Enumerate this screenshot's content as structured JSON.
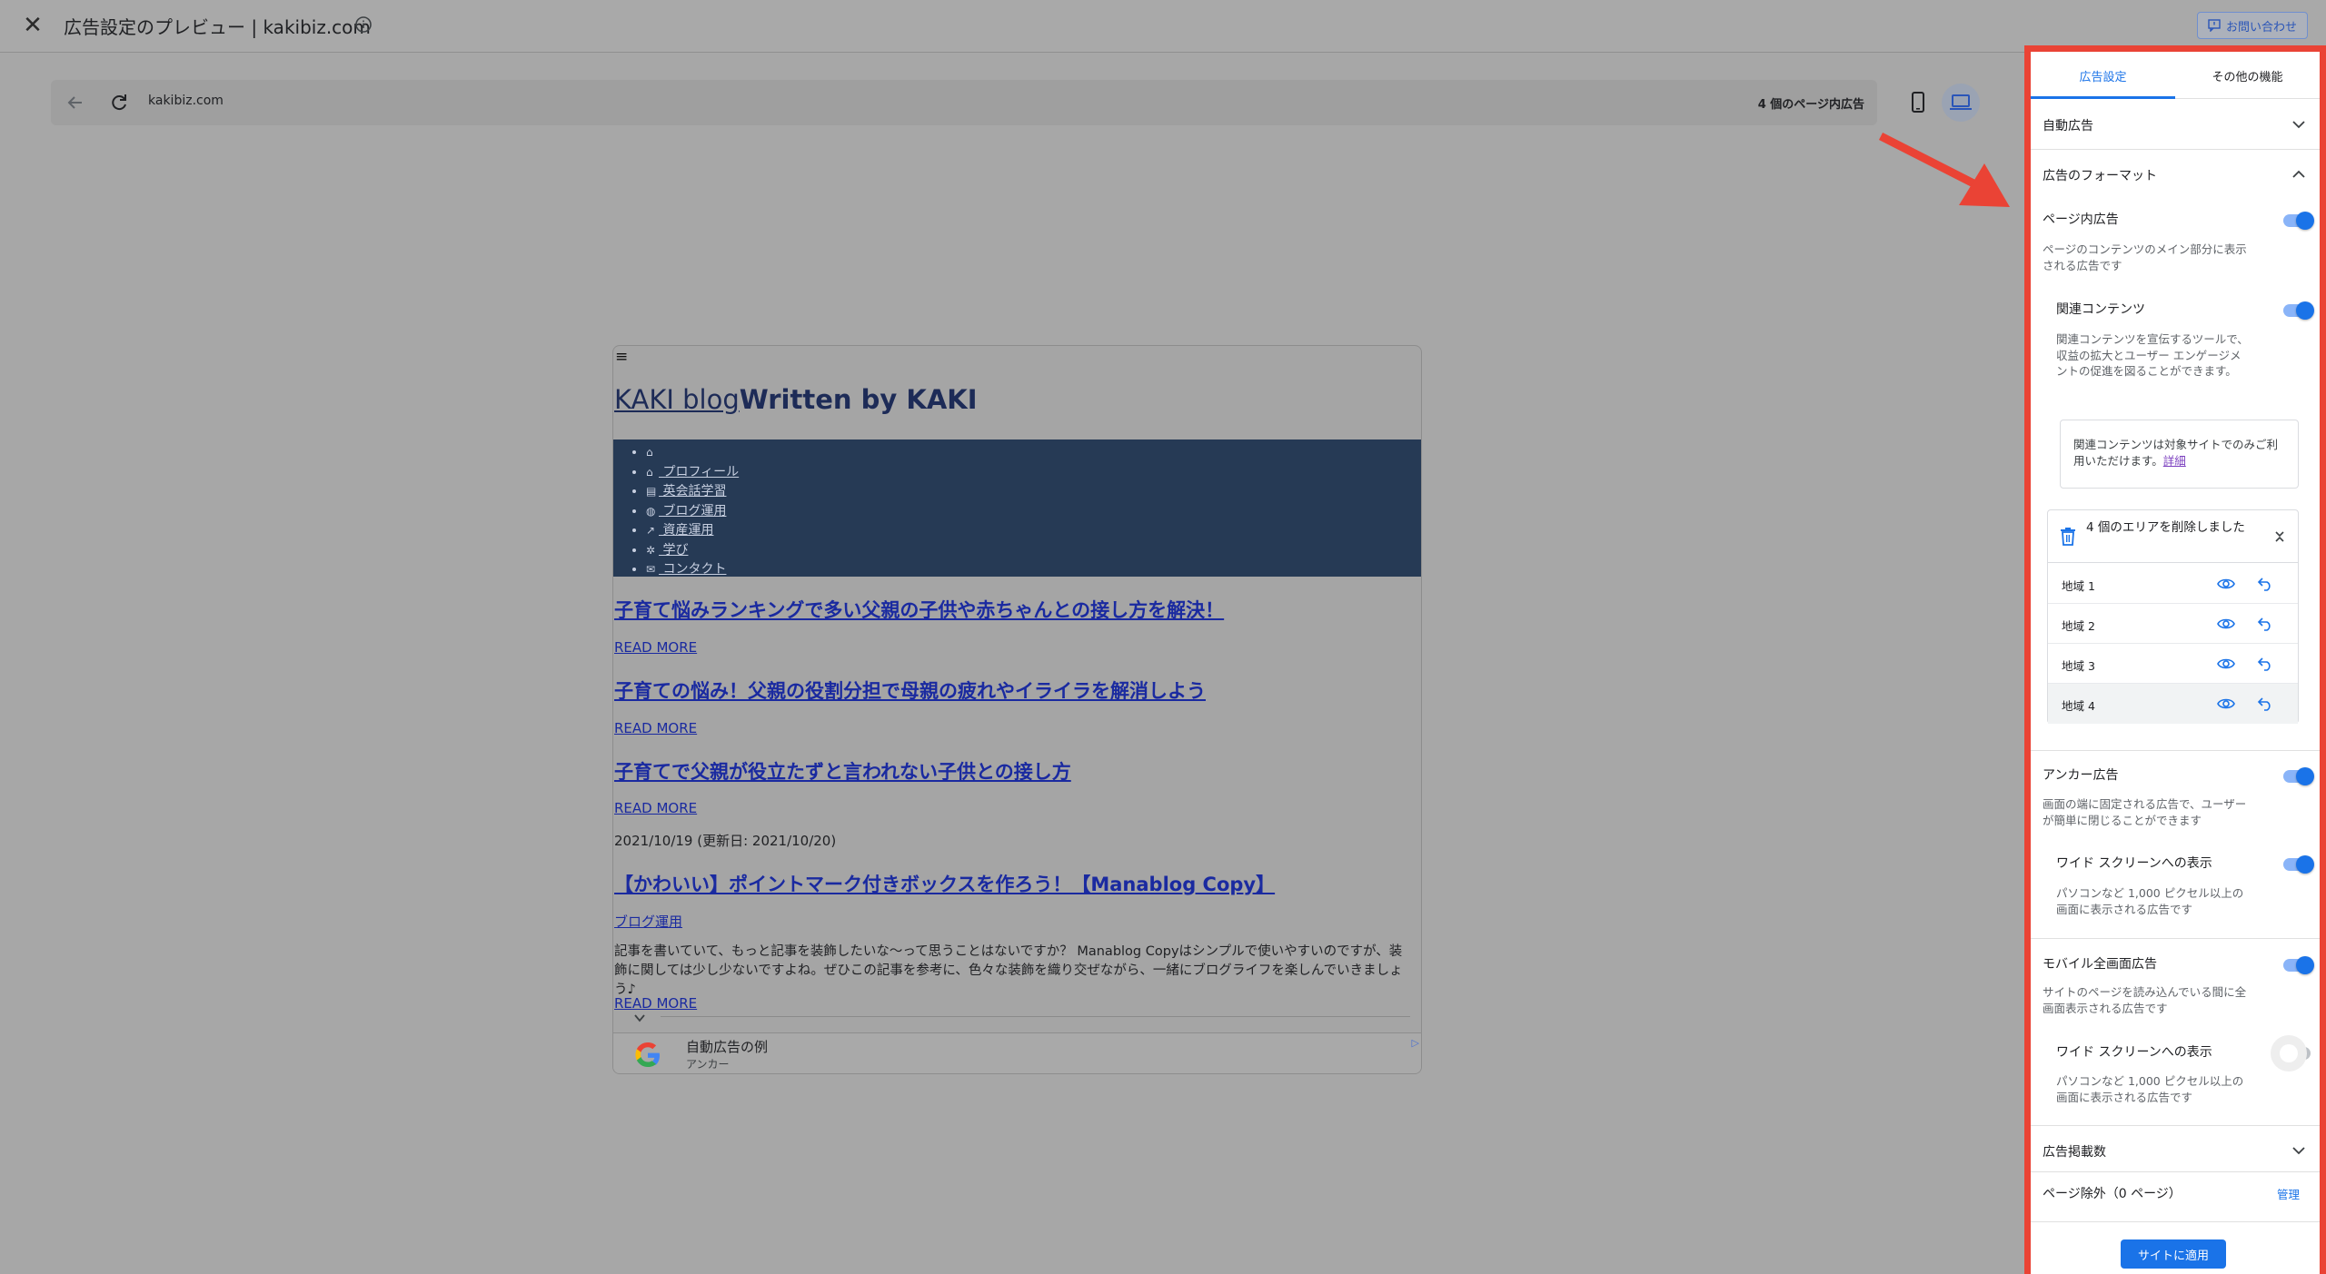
{
  "header": {
    "title": "広告設定のプレビュー | kakibiz.com",
    "contact_label": "お問い合わせ"
  },
  "addressbar": {
    "url": "kakibiz.com",
    "ads_count": "4 個のページ内広告"
  },
  "preview": {
    "hamburger": "≡",
    "blog_title_part1": "KAKI blog",
    "blog_title_part2": "Written by KAKI",
    "nav_items": [
      {
        "icon": "home-icon",
        "label": ""
      },
      {
        "icon": "home-icon",
        "label": " プロフィール"
      },
      {
        "icon": "book-icon",
        "label": " 英会話学習"
      },
      {
        "icon": "globe-icon",
        "label": " ブログ運用"
      },
      {
        "icon": "chart-icon",
        "label": " 資産運用"
      },
      {
        "icon": "spinner-icon",
        "label": " 学び"
      },
      {
        "icon": "mail-icon",
        "label": " コンタクト"
      }
    ],
    "posts": [
      "子育て悩みランキングで多い父親の子供や赤ちゃんとの接し方を解決！",
      "子育ての悩み！父親の役割分担で母親の疲れやイライラを解消しよう",
      "子育てで父親が役立たずと言われない子供との接し方",
      "【かわいい】ポイントマーク付きボックスを作ろう！【Manablog Copy】"
    ],
    "read_more": "READ MORE",
    "date": "2021/10/19 (更新日: 2021/10/20)",
    "category": "ブログ運用",
    "excerpt": "記事を書いていて、もっと記事を装飾したいな〜って思うことはないですか？ Manablog Copyはシンプルで使いやすいのですが、装飾に関しては少し少ないですよね。ぜひこの記事を参考に、色々な装飾を織り交ぜながら、一緒にブログライフを楽しんでいきましょう♪",
    "anchor_ad_title": "自動広告の例",
    "anchor_ad_sub": "アンカー"
  },
  "panel": {
    "tabs": [
      "広告設定",
      "その他の機能"
    ],
    "auto_ads": "自動広告",
    "ad_formats": "広告のフォーマット",
    "in_page": {
      "title": "ページ内広告",
      "desc": "ページのコンテンツのメイン部分に表示される広告です",
      "enabled": true
    },
    "related": {
      "title": "関連コンテンツ",
      "desc": "関連コンテンツを宣伝するツールで、収益の拡大とユーザー エンゲージメントの促進を図ることができます。",
      "enabled": true,
      "notice": "関連コンテンツは対象サイトでのみご利用いただけます。",
      "notice_link": "詳細"
    },
    "removed": {
      "header": "4 個のエリアを削除しました",
      "areas": [
        "地域 1",
        "地域 2",
        "地域 3",
        "地域 4"
      ]
    },
    "anchor": {
      "title": "アンカー広告",
      "desc": "画面の端に固定される広告で、ユーザーが簡単に閉じることができます",
      "enabled": true,
      "wide_title": "ワイド スクリーンへの表示",
      "wide_desc": "パソコンなど 1,000 ピクセル以上の画面に表示される広告です",
      "wide_enabled": true
    },
    "vignette": {
      "title": "モバイル全画面広告",
      "desc": "サイトのページを読み込んでいる間に全画面表示される広告です",
      "enabled": true,
      "wide_title": "ワイド スクリーンへの表示",
      "wide_desc": "パソコンなど 1,000 ピクセル以上の画面に表示される広告です",
      "wide_enabled": false
    },
    "ad_load": "広告掲載数",
    "page_exclusion": "ページ除外（0 ページ）",
    "manage": "管理",
    "apply": "サイトに適用"
  },
  "colors": {
    "accent": "#1a73e8",
    "highlight_border": "#ea4335",
    "nav_band": "#263a55",
    "link": "#1a2aa0"
  }
}
